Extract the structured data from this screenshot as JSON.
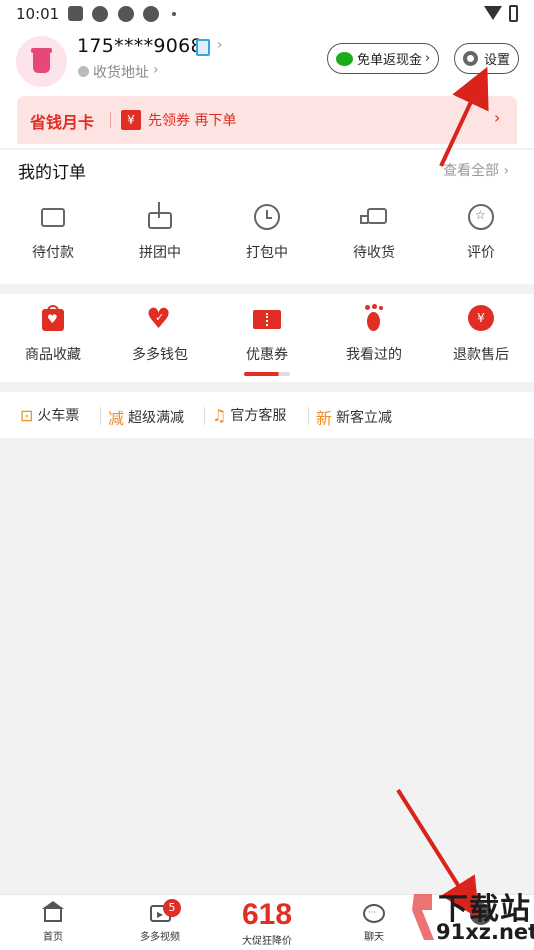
{
  "status_bar": {
    "time": "10:01"
  },
  "profile": {
    "phone": "175****9068",
    "address_label": "收货地址",
    "cashback_button": "免单返现金",
    "settings_button": "设置"
  },
  "money_card": {
    "title": "省钱月卡",
    "coupon_text": "先领券 再下单",
    "ticket_symbol": "¥"
  },
  "orders": {
    "title": "我的订单",
    "view_all": "查看全部",
    "items": [
      {
        "label": "待付款",
        "icon": "wallet-icon"
      },
      {
        "label": "拼团中",
        "icon": "share-icon"
      },
      {
        "label": "打包中",
        "icon": "clock-icon"
      },
      {
        "label": "待收货",
        "icon": "truck-icon"
      },
      {
        "label": "评价",
        "icon": "star-badge-icon"
      }
    ]
  },
  "tools": {
    "items": [
      {
        "label": "商品收藏",
        "icon": "heart-bag-icon"
      },
      {
        "label": "多多钱包",
        "icon": "wallet-heart-icon"
      },
      {
        "label": "优惠券",
        "icon": "coupon-icon"
      },
      {
        "label": "我看过的",
        "icon": "footprint-icon"
      },
      {
        "label": "退款售后",
        "icon": "refund-icon",
        "symbol": "¥"
      }
    ]
  },
  "extras": {
    "items": [
      {
        "label": "火车票",
        "icon": "train-icon",
        "glyph": "⊡"
      },
      {
        "label": "超级满减",
        "icon": "discount-icon",
        "glyph": "减"
      },
      {
        "label": "官方客服",
        "icon": "headset-icon",
        "glyph": "♫"
      },
      {
        "label": "新客立减",
        "icon": "new-user-icon",
        "glyph": "新"
      }
    ]
  },
  "bottom_nav": {
    "items": [
      {
        "label": "首页",
        "icon": "home-icon"
      },
      {
        "label": "多多视频",
        "icon": "video-icon",
        "badge": "5"
      },
      {
        "label": "大促狂降价",
        "icon": "promo-618",
        "big": "618"
      },
      {
        "label": "聊天",
        "icon": "chat-icon"
      },
      {
        "label": "",
        "icon": "profile-icon"
      }
    ]
  },
  "watermark": {
    "title": "下载站",
    "site": "91xz.net"
  },
  "colors": {
    "brand_red": "#e02e24",
    "orange": "#f08c28",
    "wechat_green": "#1aad19",
    "annotation_red": "#d9231c"
  }
}
